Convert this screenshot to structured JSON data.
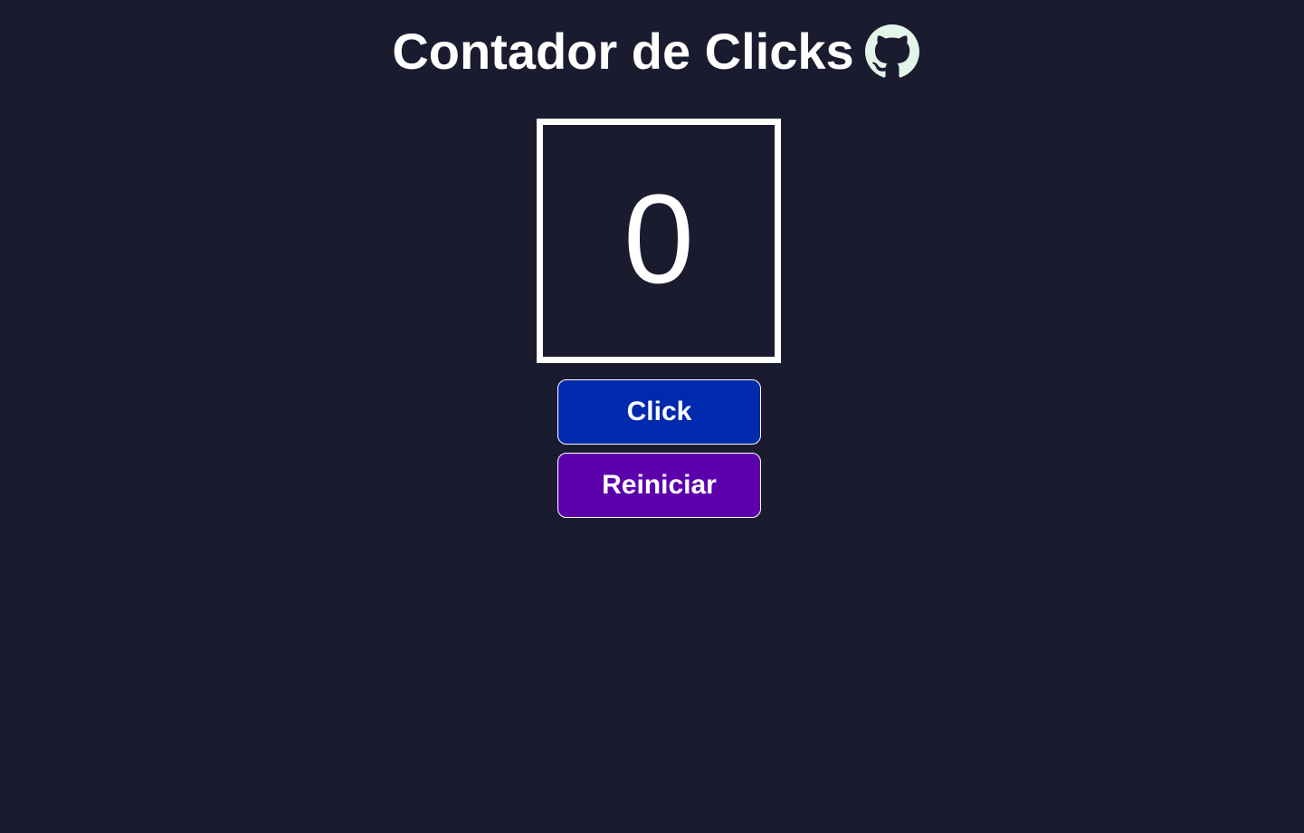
{
  "header": {
    "title": "Contador de Clicks",
    "github_icon": "github-icon"
  },
  "counter": {
    "value": "0"
  },
  "buttons": {
    "click_label": "Click",
    "reset_label": "Reiniciar"
  },
  "colors": {
    "background": "#1b1b30",
    "click_button": "#002aad",
    "reset_button": "#5b00ab",
    "github_icon": "#e3f5e9",
    "text": "#ffffff"
  }
}
